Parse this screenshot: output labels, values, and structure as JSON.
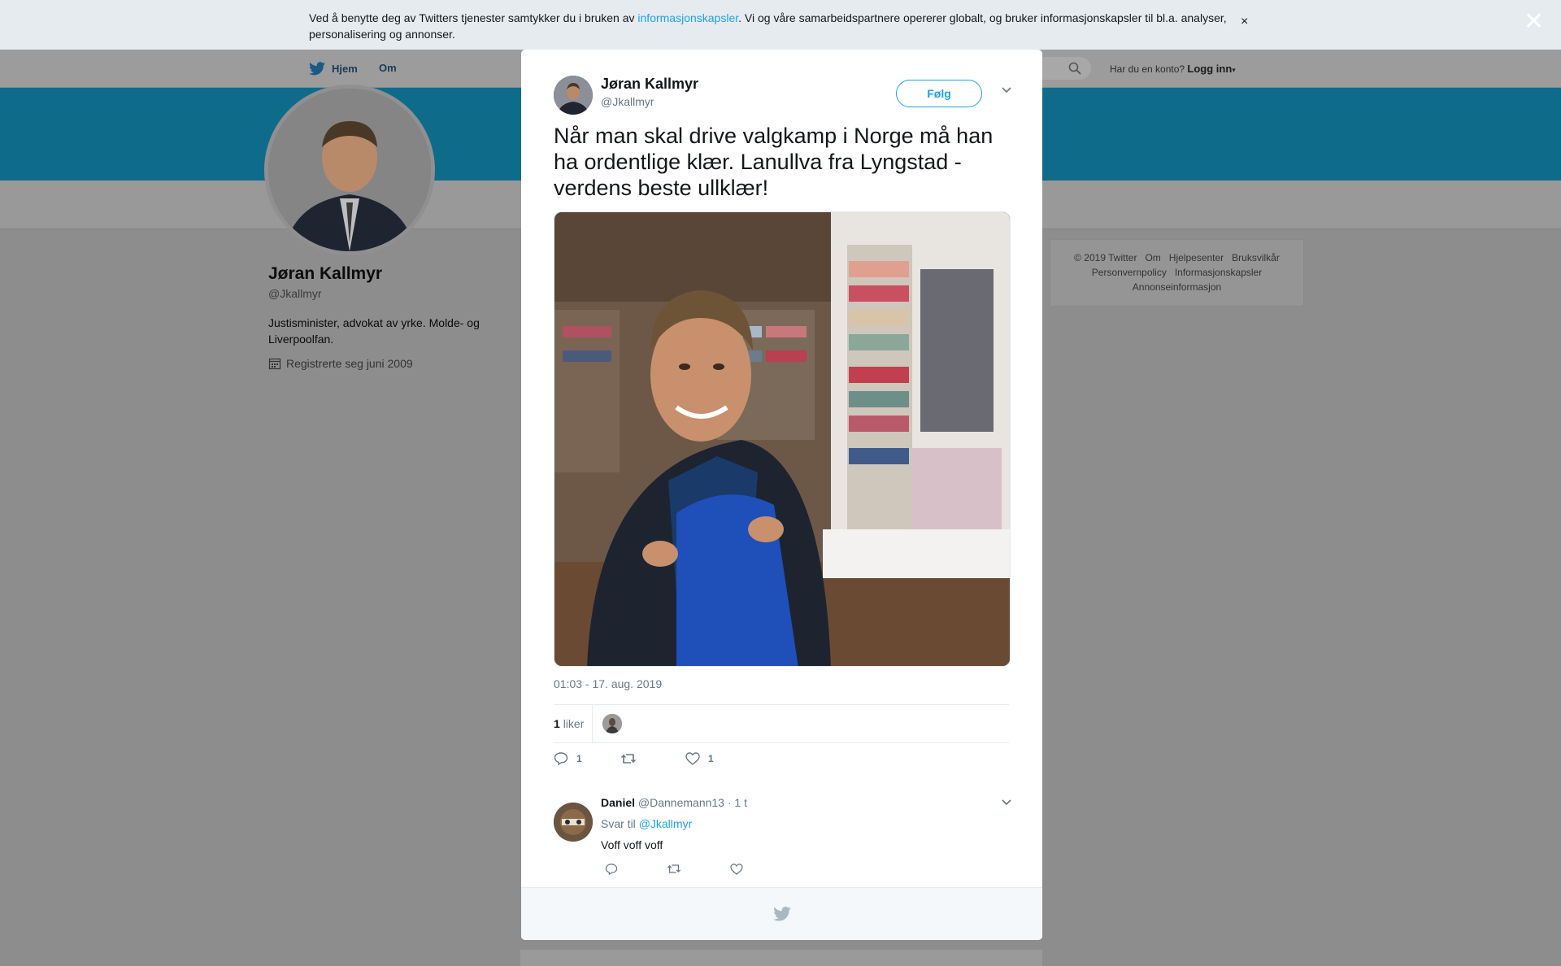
{
  "cookie_bar": {
    "text_before": "Ved å benytte deg av Twitters tjenester samtykker du i bruken av ",
    "link": "informasjonskapsler",
    "text_after": ". Vi og våre samarbeidspartnere opererer globalt, og bruker informasjonskapsler til bl.a. analyser, personalisering og annonser.",
    "close": "×"
  },
  "nav": {
    "home": "Hjem",
    "about": "Om",
    "account_prompt": "Har du en konto?",
    "login": "Logg inn"
  },
  "profile": {
    "name": "Jøran Kallmyr",
    "handle": "@Jkallmyr",
    "bio": "Justisminister, advokat av yrke. Molde- og Liverpoolfan.",
    "joined": "Registrerte seg juni 2009"
  },
  "footer": {
    "links": [
      "© 2019 Twitter",
      "Om",
      "Hjelpesenter",
      "Bruksvilkår",
      "Personvernpolicy",
      "Informasjonskapsler",
      "Annonseinformasjon"
    ]
  },
  "modal": {
    "close": "✕",
    "author_name": "Jøran Kallmyr",
    "author_handle": "@Jkallmyr",
    "follow": "Følg",
    "tweet_text": "Når man skal drive valgkamp i Norge må han ha ordentlige klær. Lanullva fra Lyngstad - verdens beste ullklær!",
    "timestamp": "01:03 - 17. aug. 2019",
    "likes_count": "1",
    "likes_label": "liker",
    "reply_count": "1",
    "like_count": "1",
    "reply": {
      "name": "Daniel",
      "handle": "@Dannemann13",
      "time": "· 1 t",
      "reply_to_label": "Svar til",
      "reply_to_handle": "@Jkallmyr",
      "text": "Voff voff voff"
    }
  },
  "colors": {
    "accent": "#1da1f2",
    "banner": "#0f6b8a",
    "overlay": "#8d8d8d"
  }
}
